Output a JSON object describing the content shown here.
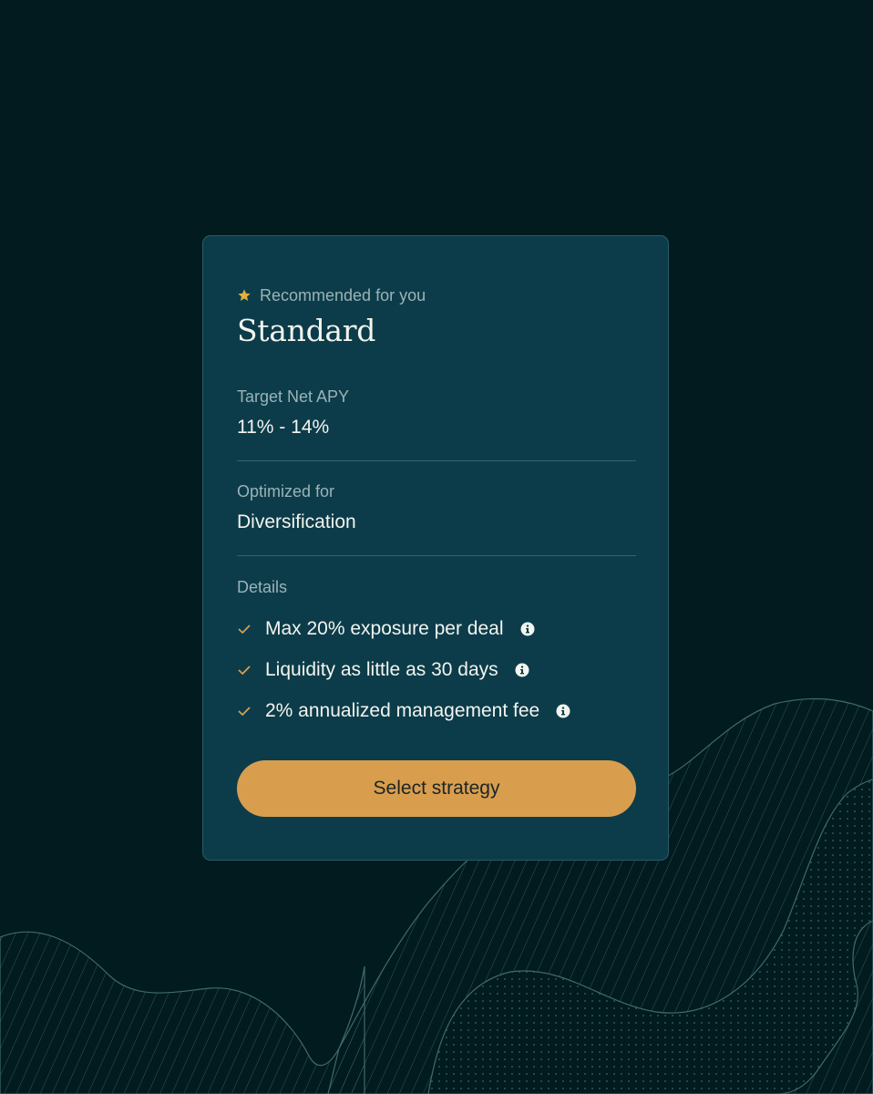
{
  "card": {
    "badge_label": "Recommended for you",
    "badge_icon": "star-icon",
    "title": "Standard",
    "sections": [
      {
        "label": "Target Net APY",
        "value": "11% - 14%"
      },
      {
        "label": "Optimized for",
        "value": "Diversification"
      }
    ],
    "details_label": "Details",
    "details": [
      {
        "text": "Max 20% exposure per deal",
        "icon": "check-icon",
        "info_icon": "info-icon"
      },
      {
        "text": "Liquidity as little as 30 days",
        "icon": "check-icon",
        "info_icon": "info-icon"
      },
      {
        "text": "2% annualized management fee",
        "icon": "check-icon",
        "info_icon": "info-icon"
      }
    ],
    "cta_label": "Select strategy"
  },
  "colors": {
    "background": "#021b1f",
    "card": "#0c3c4a",
    "accent": "#d89e4e",
    "star": "#e2b23c",
    "text_primary": "#f3f4ef",
    "text_muted": "#9bb3b7"
  }
}
